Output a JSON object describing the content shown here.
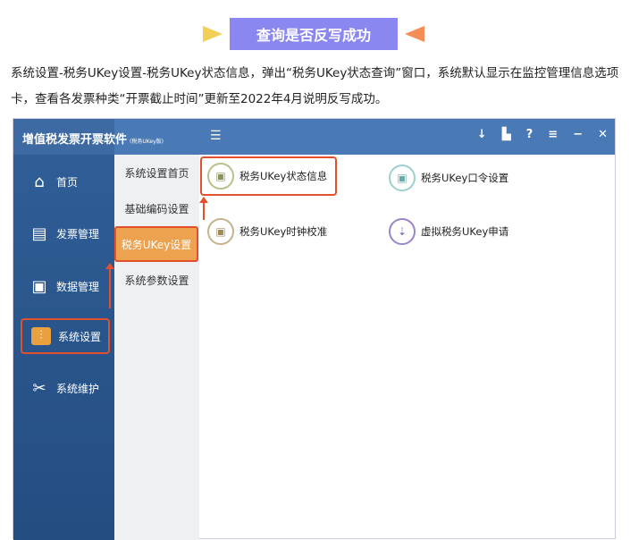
{
  "banner": {
    "title": "查询是否反写成功"
  },
  "description": "系统设置-税务UKey设置-税务UKey状态信息，弹出“税务UKey状态查询”窗口，系统默认显示在监控管理信息选项卡，查看各发票种类“开票截止时间”更新至2022年4月说明反写成功。",
  "app": {
    "title": "增值税发票开票软件",
    "edition": "(税务UKey版)"
  },
  "sidebar": {
    "items": [
      {
        "label": "首页",
        "icon": "home-icon"
      },
      {
        "label": "发票管理",
        "icon": "printer-icon"
      },
      {
        "label": "数据管理",
        "icon": "data-icon"
      },
      {
        "label": "系统设置",
        "icon": "settings-icon"
      },
      {
        "label": "系统维护",
        "icon": "tools-icon"
      }
    ]
  },
  "submenu": {
    "items": [
      {
        "label": "系统设置首页"
      },
      {
        "label": "基础编码设置"
      },
      {
        "label": "税务UKey设置"
      },
      {
        "label": "系统参数设置"
      }
    ]
  },
  "content": {
    "items": [
      {
        "label": "税务UKey状态信息",
        "color": "#b9c08a"
      },
      {
        "label": "税务UKey口令设置",
        "color": "#9fcfcf"
      },
      {
        "label": "税务UKey时钟校准",
        "color": "#c7b38c"
      },
      {
        "label": "虚拟税务UKey申请",
        "color": "#9a86c9"
      }
    ]
  },
  "colors": {
    "accent": "#e2502e",
    "titlebar": "#4a7ab5",
    "banner": "#8b87f0"
  }
}
